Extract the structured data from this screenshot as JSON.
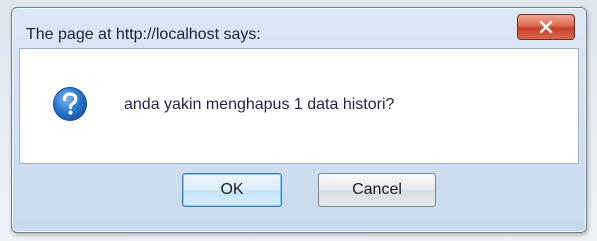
{
  "dialog": {
    "title": "The page at http://localhost says:",
    "message": "anda yakin menghapus 1 data histori?",
    "icon": "question-icon",
    "buttons": {
      "ok": "OK",
      "cancel": "Cancel"
    }
  },
  "colors": {
    "title_bar": "#d2e1f2",
    "close_button": "#d65a42",
    "icon_blue": "#1f6fc8",
    "ok_border": "#3c7fb1"
  }
}
